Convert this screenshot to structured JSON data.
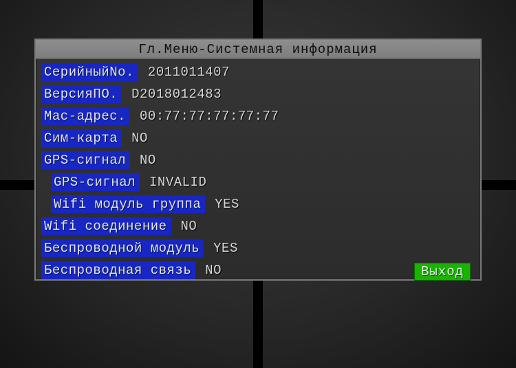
{
  "title": "Гл.Меню-Системная информация",
  "rows": [
    {
      "label": "СерийныйNo.",
      "value": "2011011407",
      "indent": false
    },
    {
      "label": "ВерсияПО.",
      "value": "D2018012483",
      "indent": false
    },
    {
      "label": "Mac-адрес.",
      "value": "00:77:77:77:77:77",
      "indent": false
    },
    {
      "label": "Сим-карта",
      "value": "NO",
      "indent": false
    },
    {
      "label": "GPS-сигнал",
      "value": "NO",
      "indent": false
    },
    {
      "label": "GPS-сигнал",
      "value": "INVALID",
      "indent": true
    },
    {
      "label": "Wifi модуль группа",
      "value": "YES",
      "indent": true
    },
    {
      "label": "Wifi соединение",
      "value": "NO",
      "indent": false
    },
    {
      "label": "Беспроводной модуль",
      "value": "YES",
      "indent": false
    },
    {
      "label": "Беспроводная связь",
      "value": "NO",
      "indent": false
    }
  ],
  "exit_label": "Выход"
}
